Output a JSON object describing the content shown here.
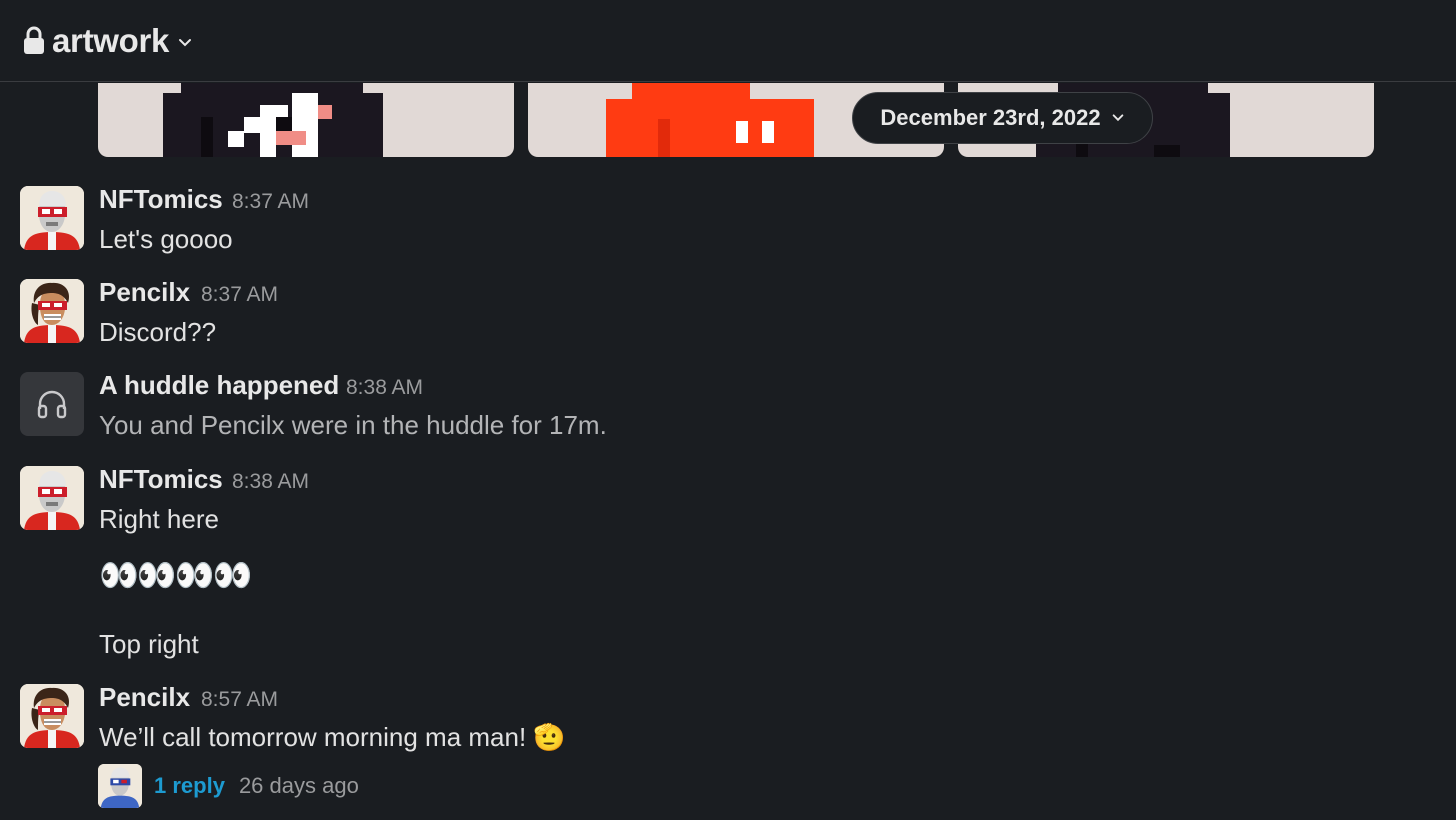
{
  "channel": {
    "name": "artwork",
    "lock_icon": "lock-icon",
    "chevron_icon": "chevron-down-icon"
  },
  "date_divider": {
    "label": "December 23rd, 2022"
  },
  "messages": [
    {
      "sender": "NFTomics",
      "time": "8:37 AM",
      "lines": [
        "Let's goooo"
      ]
    },
    {
      "sender": "Pencilx",
      "time": "8:37 AM",
      "lines": [
        "Discord??"
      ]
    },
    {
      "sender": "A huddle happened",
      "time": "8:38 AM",
      "lines": [
        "You and Pencilx were in the huddle for 17m."
      ],
      "icon": "headphones-icon"
    },
    {
      "sender": "NFTomics",
      "time": "8:38 AM",
      "lines": [
        "Right here",
        "👀👀👀👀",
        "Top right"
      ]
    },
    {
      "sender": "Pencilx",
      "time": "8:57 AM",
      "lines": [
        "We’ll call tomorrow morning ma man! 🫡"
      ]
    }
  ],
  "thread": {
    "reply_link": "1 reply",
    "last_reply": "26 days ago"
  },
  "colors": {
    "background": "#1a1d21",
    "link": "#1d9bd1",
    "avatar_red": "#d8271f",
    "thumb_orange": "#ff3b12"
  }
}
